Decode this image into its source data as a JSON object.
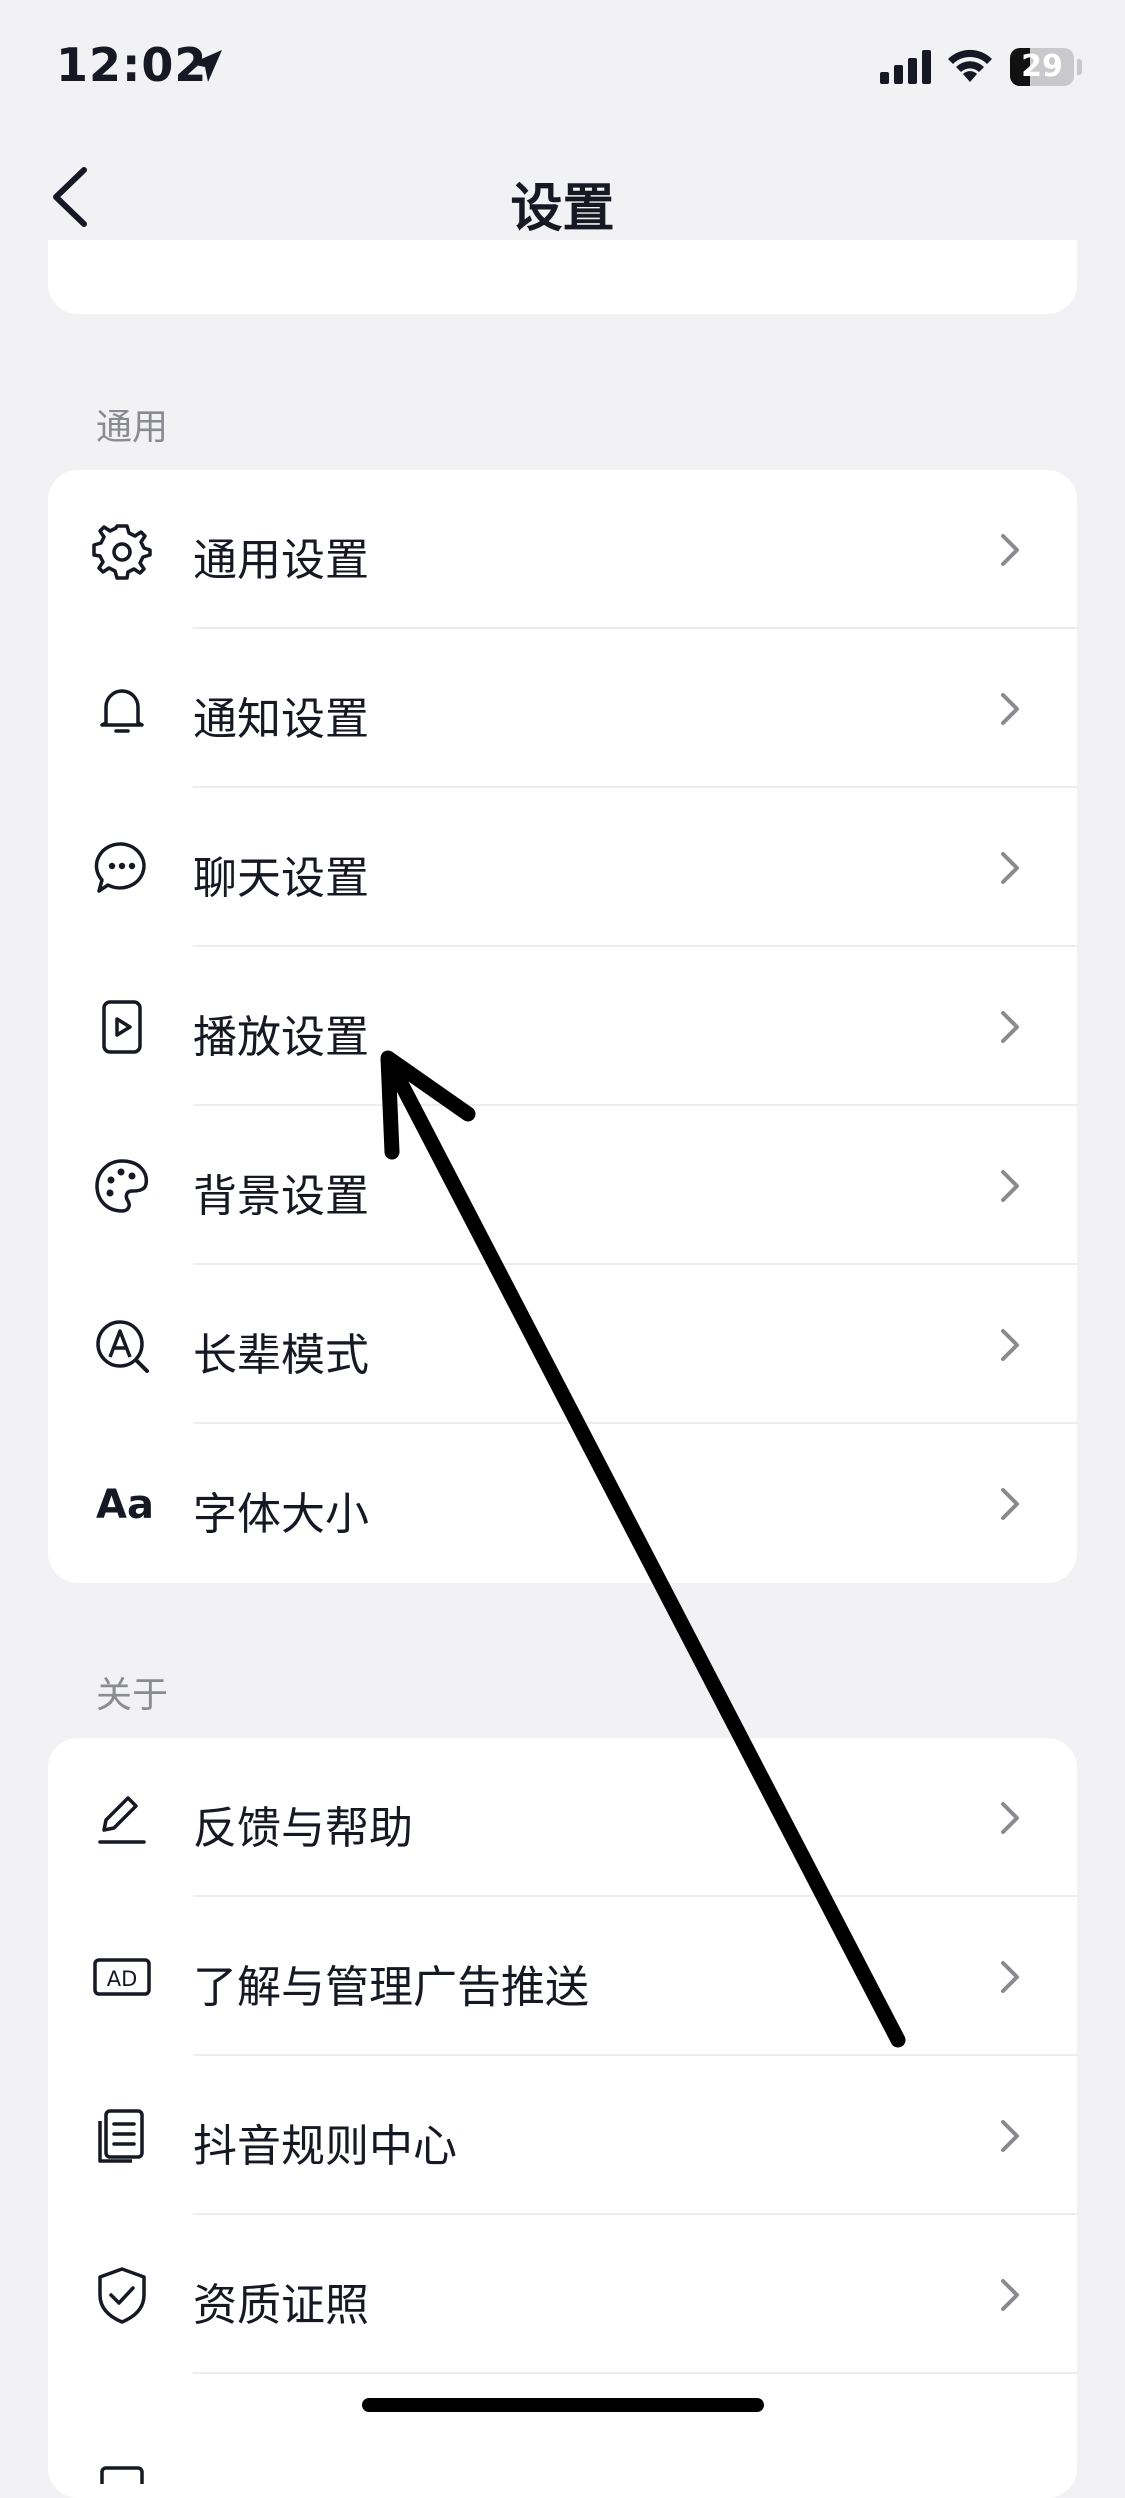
{
  "status_bar": {
    "time": "12:02",
    "battery": "29"
  },
  "nav": {
    "title": "设置",
    "back_icon": "chevron-left-icon"
  },
  "sections": [
    {
      "label": "通用",
      "items": [
        {
          "label": "通用设置",
          "icon": "gear-icon"
        },
        {
          "label": "通知设置",
          "icon": "bell-icon"
        },
        {
          "label": "聊天设置",
          "icon": "chat-bubble-icon"
        },
        {
          "label": "播放设置",
          "icon": "play-screen-icon"
        },
        {
          "label": "背景设置",
          "icon": "palette-icon"
        },
        {
          "label": "长辈模式",
          "icon": "elder-mode-icon"
        },
        {
          "label": "字体大小",
          "icon": "font-size-icon",
          "icon_text": "Aa"
        }
      ]
    },
    {
      "label": "关于",
      "items": [
        {
          "label": "反馈与帮助",
          "icon": "pencil-icon"
        },
        {
          "label": "了解与管理广告推送",
          "icon": "ad-icon",
          "icon_text": "AD"
        },
        {
          "label": "抖音规则中心",
          "icon": "document-list-icon"
        },
        {
          "label": "资质证照",
          "icon": "shield-check-icon"
        }
      ]
    }
  ],
  "colors": {
    "background": "#f2f2f4",
    "card": "#ffffff",
    "text": "#161823",
    "secondary_text": "#8a8b91",
    "chevron": "#8a8b91",
    "annotation_arrow": "#000000"
  }
}
